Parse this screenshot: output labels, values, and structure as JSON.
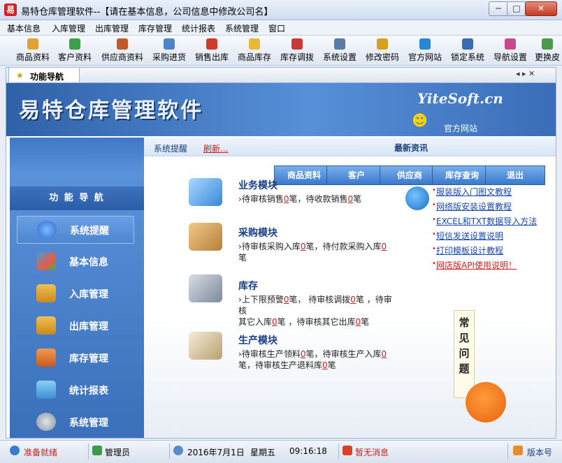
{
  "window": {
    "app_icon_text": "易",
    "title": "易特仓库管理软件--【请在基本信息，公司信息中修改公司名】",
    "min_label": "─",
    "max_label": "□",
    "close_label": "✕"
  },
  "menu": [
    "基本信息",
    "入库管理",
    "出库管理",
    "库存管理",
    "统计报表",
    "系统管理",
    "窗口"
  ],
  "toolbar": [
    {
      "label": "商品资料",
      "icon": "goods-icon",
      "color": "#e0a232"
    },
    {
      "label": "客户资料",
      "icon": "customers-icon",
      "color": "#3aa04a"
    },
    {
      "label": "供应商资料",
      "icon": "suppliers-icon",
      "color": "#c05a2a"
    },
    {
      "label": "采购进货",
      "icon": "purchase-icon",
      "color": "#4c86c8"
    },
    {
      "label": "销售出库",
      "icon": "sales-icon",
      "color": "#d03a2a"
    },
    {
      "label": "商品库存",
      "icon": "stock-icon",
      "color": "#e8b838"
    },
    {
      "label": "库存调拨",
      "icon": "transfer-icon",
      "color": "#c83a3a"
    },
    {
      "label": "系统设置",
      "icon": "settings-icon",
      "color": "#5a7aa8"
    },
    {
      "label": "修改密码",
      "icon": "password-icon",
      "color": "#d8a020"
    },
    {
      "label": "官方网站",
      "icon": "website-icon",
      "color": "#2a86d8"
    },
    {
      "label": "锁定系统",
      "icon": "lock-icon",
      "color": "#3a6ab8"
    },
    {
      "label": "导航设置",
      "icon": "nav-settings-icon",
      "color": "#c84a8a"
    },
    {
      "label": "更换皮",
      "icon": "skin-icon",
      "color": "#4a9a4a"
    }
  ],
  "tab": {
    "label": "功能导航",
    "controls": "◂ ▸ ✕"
  },
  "banner": {
    "title": "易特仓库管理软件",
    "site": "YiteSoft.cn",
    "official_site": "官方网站"
  },
  "sidebar": {
    "title": "功 能 导 航",
    "items": [
      {
        "label": "系统提醒",
        "icon": "info-icon",
        "color": "#2a6ad0",
        "selected": true
      },
      {
        "label": "基本信息",
        "icon": "cubes-icon",
        "color": "#3aa0d8",
        "selected": false
      },
      {
        "label": "入库管理",
        "icon": "stock-in-icon",
        "color": "#e8b030",
        "selected": false
      },
      {
        "label": "出库管理",
        "icon": "stock-out-icon",
        "color": "#e8b030",
        "selected": false
      },
      {
        "label": "库存管理",
        "icon": "warehouse-icon",
        "color": "#e88a40",
        "selected": false
      },
      {
        "label": "统计报表",
        "icon": "chart-icon",
        "color": "#5ab0e0",
        "selected": false
      },
      {
        "label": "系统管理",
        "icon": "gears-icon",
        "color": "#b0b8c4",
        "selected": false
      }
    ]
  },
  "content": {
    "sys_reminder": "系统提醒",
    "refresh": "刷新...",
    "news_title": "最新资讯",
    "quick_buttons": [
      "商品资料",
      "客户",
      "供应商",
      "库存查询",
      "退出"
    ],
    "modules": [
      {
        "title": "业务模块",
        "icon": "business-icon",
        "color": "#5aa8e8",
        "lines": [
          [
            "待审核销售",
            "0",
            "笔，待收款销售",
            "0",
            "笔"
          ]
        ]
      },
      {
        "title": "采购模块",
        "icon": "purchase-box-icon",
        "color": "#d8a04a",
        "lines": [
          [
            "待审核采购入库",
            "0",
            "笔，待付款采购入库",
            "0",
            ""
          ],
          [
            "笔",
            "",
            "",
            "",
            ""
          ]
        ]
      },
      {
        "title": "库存",
        "icon": "database-icon",
        "color": "#8a9aaa",
        "lines": [
          [
            "上下限预警",
            "0",
            "笔，   待审核调拨",
            "0",
            "笔  ，待审核"
          ],
          [
            "其它入库",
            "0",
            "笔  ，待审核其它出库",
            "0",
            "笔"
          ]
        ]
      },
      {
        "title": "生产模块",
        "icon": "clipboard-icon",
        "color": "#b08a5a",
        "lines": [
          [
            "待审核生产领料",
            "0",
            "笔，待审核生产入库",
            "0",
            ""
          ],
          [
            "笔，待审核生产退料库",
            "0",
            "笔",
            "",
            ""
          ]
        ]
      }
    ],
    "news": [
      {
        "text": "服装版入门图文教程",
        "red": false
      },
      {
        "text": "网络版安装设置教程",
        "red": false
      },
      {
        "text": "EXCEL和TXT数据导入方法",
        "red": false
      },
      {
        "text": "短信发送设置说明",
        "red": false
      },
      {
        "text": "打印模板设计教程",
        "red": false
      },
      {
        "text": "网店版API使用说明！",
        "red": true
      }
    ],
    "faq": "常见问题"
  },
  "status": {
    "ready": "准备就绪",
    "user": "管理员",
    "date": "2016年7月1日",
    "weekday": "星期五",
    "time": "09:16:18",
    "message": "暂无消息",
    "version": "版本号"
  }
}
